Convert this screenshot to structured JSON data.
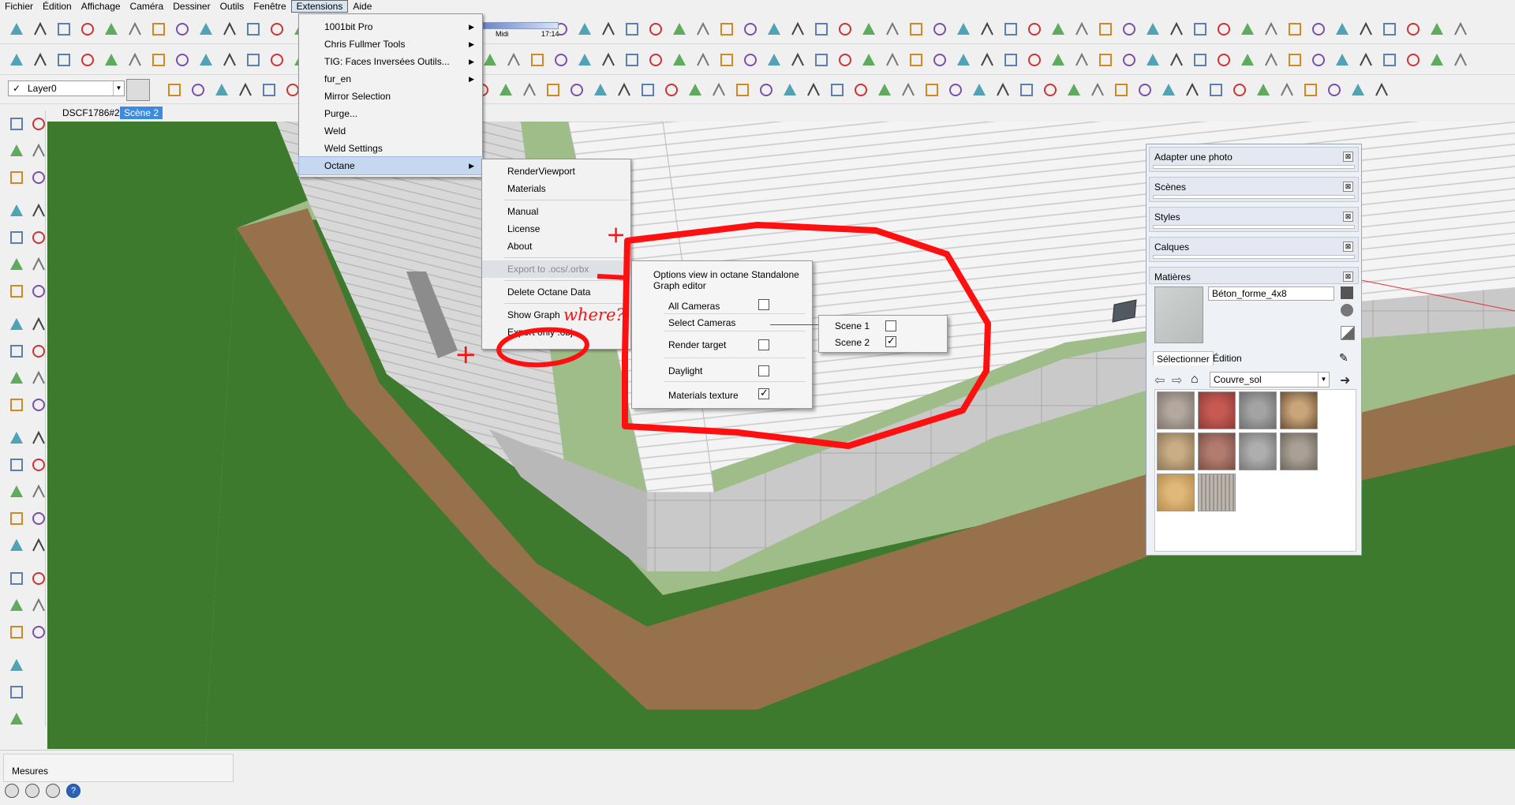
{
  "menubar": {
    "items": [
      "Fichier",
      "Édition",
      "Affichage",
      "Caméra",
      "Dessiner",
      "Outils",
      "Fenêtre",
      "Extensions",
      "Aide"
    ],
    "active_index": 7
  },
  "shadows": {
    "label_start": "Midi",
    "label_end": "17:14"
  },
  "layer": {
    "current": "Layer0"
  },
  "scene_tabs": [
    "DSCF1786#2",
    "Scène 2"
  ],
  "active_scene_tab": 1,
  "extensions_menu": {
    "items": [
      {
        "label": "1001bit Pro",
        "submenu": true
      },
      {
        "label": "Chris Fullmer Tools",
        "submenu": true
      },
      {
        "label": "TIG: Faces Inversées Outils...",
        "submenu": true
      },
      {
        "label": "fur_en",
        "submenu": true
      },
      {
        "label": "Mirror Selection",
        "submenu": false
      },
      {
        "label": "Purge...",
        "submenu": false
      },
      {
        "label": "Weld",
        "submenu": false
      },
      {
        "label": "Weld Settings",
        "submenu": false
      },
      {
        "label": "Octane",
        "submenu": true,
        "highlighted": true
      }
    ]
  },
  "octane_menu": {
    "render_viewport": "RenderViewport",
    "materials": "Materials",
    "manual": "Manual",
    "license": "License",
    "about": "About",
    "export": "Export to .ocs/.orbx",
    "delete": "Delete Octane Data",
    "show_graph": "Show Graph",
    "export_obj": "Export only .obj"
  },
  "annotation": {
    "where": "where?",
    "plus1": "+",
    "plus2": "+"
  },
  "octane_options": {
    "title_line1": "Options view in octane Standalone",
    "title_line2": "Graph editor",
    "all_cameras": "All Cameras",
    "select_cameras": "Select Cameras",
    "render_target": "Render target",
    "daylight": "Daylight",
    "materials_texture": "Materials texture",
    "materials_texture_checked": true
  },
  "cameras_popup": {
    "scenes": [
      {
        "label": "Scene 1",
        "checked": false
      },
      {
        "label": "Scene 2",
        "checked": true
      }
    ]
  },
  "tray": {
    "panels": [
      "Adapter une photo",
      "Scènes",
      "Styles",
      "Calques",
      "Matières"
    ],
    "close_glyph": "⊠",
    "material_name": "Béton_forme_4x8",
    "tabs": [
      "Sélectionner",
      "Édition"
    ],
    "collection": "Couvre_sol"
  },
  "status": {
    "measures_label": "Mesures",
    "help_glyph": "?"
  },
  "colors": {
    "annotation_red": "#ff1010",
    "menu_highlight": "#c5d8ef",
    "grass": "#3e7a2e",
    "soil": "#96714b",
    "sky_green": "#9ebd88"
  }
}
